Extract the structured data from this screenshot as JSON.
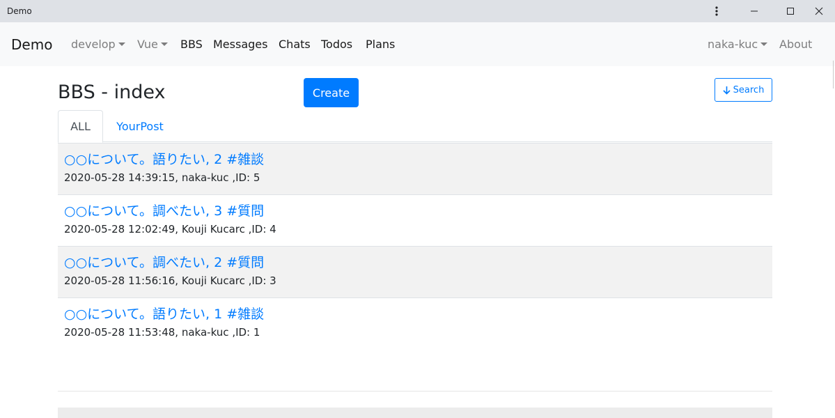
{
  "window": {
    "title": "Demo",
    "controls": {
      "menu_icon": "more-vert-icon",
      "minimize_icon": "minimize-icon",
      "maximize_icon": "maximize-icon",
      "close_icon": "close-icon"
    }
  },
  "navbar": {
    "brand": "Demo",
    "items": [
      {
        "label": "develop",
        "dropdown": true
      },
      {
        "label": "Vue",
        "dropdown": true
      },
      {
        "label": "BBS",
        "dropdown": false
      },
      {
        "label": "Messages",
        "dropdown": false
      },
      {
        "label": "Chats",
        "dropdown": false
      },
      {
        "label": "Todos",
        "dropdown": false
      },
      {
        "label": "Plans",
        "dropdown": false
      }
    ],
    "user": "naka-kuc",
    "about": "About"
  },
  "page": {
    "title": "BBS - index",
    "create_label": "Create",
    "search_label": "Search",
    "search_icon": "arrow-down-icon"
  },
  "tabs": [
    {
      "label": "ALL",
      "active": true
    },
    {
      "label": "YourPost",
      "active": false
    }
  ],
  "posts": [
    {
      "title": "○○について。語りたい, 2 #雑談",
      "meta": "2020-05-28 14:39:15, naka-kuc ,ID: 5"
    },
    {
      "title": "○○について。調べたい, 3 #質問",
      "meta": "2020-05-28 12:02:49, Kouji Kucarc ,ID: 4"
    },
    {
      "title": "○○について。調べたい, 2 #質問",
      "meta": "2020-05-28 11:56:16, Kouji Kucarc ,ID: 3"
    },
    {
      "title": "○○について。語りたい, 1 #雑談",
      "meta": "2020-05-28 11:53:48, naka-kuc ,ID: 1"
    }
  ],
  "colors": {
    "primary": "#007bff",
    "navbar_bg": "#f8f9fa",
    "titlebar_bg": "#dee1e6",
    "striped_row": "#f2f2f2"
  }
}
